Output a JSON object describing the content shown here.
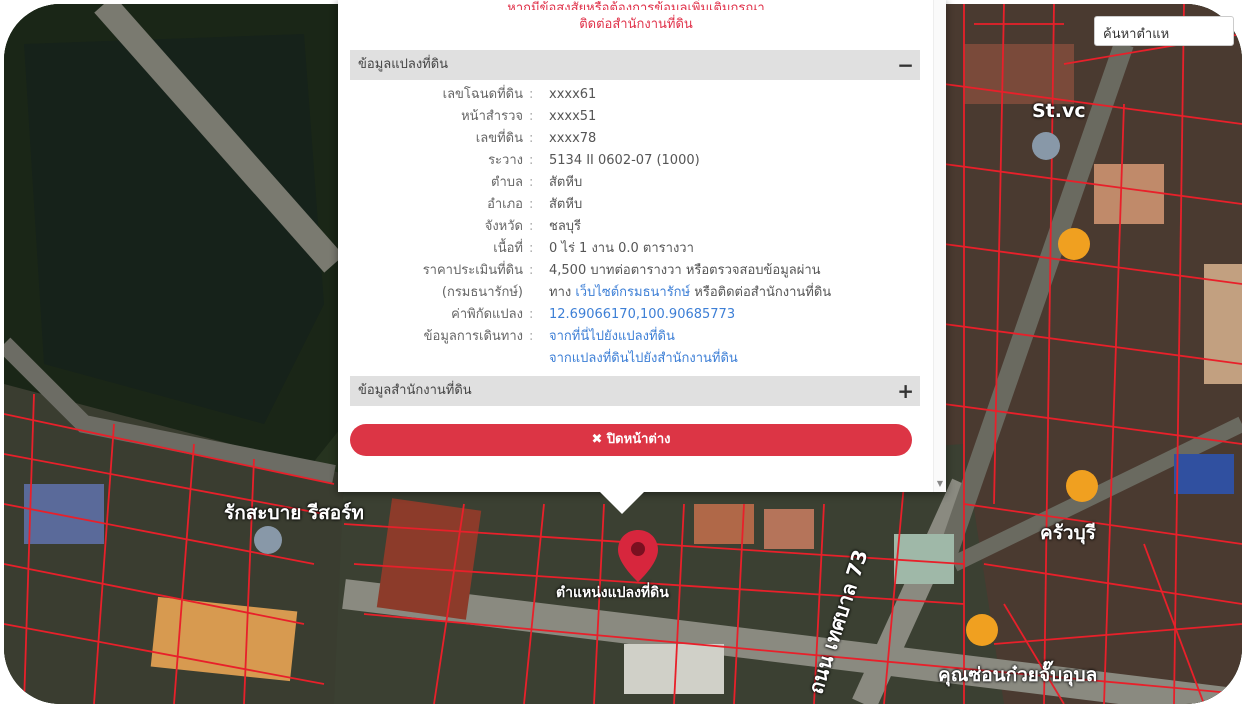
{
  "search": {
    "placeholder": "ค้นหาตำแหน่ง",
    "visible_text": "ค้นหาตำแห"
  },
  "popup": {
    "warning_cut": "หากมีข้อสงสัยหรือต้องการข้อมูลเพิ่มเติมกรุณา",
    "warning_line": "ติดต่อสำนักงานที่ดิน",
    "section1_title": "ข้อมูลแปลงที่ดิน",
    "section1_toggle": "−",
    "rows": [
      {
        "label": "เลขโฉนดที่ดิน",
        "value": "xxxx61"
      },
      {
        "label": "หน้าสำรวจ",
        "value": "xxxx51"
      },
      {
        "label": "เลขที่ดิน",
        "value": "xxxx78"
      },
      {
        "label": "ระวาง",
        "value": "5134 II 0602-07 (1000)"
      },
      {
        "label": "ตำบล",
        "value": "สัตหีบ"
      },
      {
        "label": "อำเภอ",
        "value": "สัตหีบ"
      },
      {
        "label": "จังหวัด",
        "value": "ชลบุรี"
      },
      {
        "label": "เนื้อที่",
        "value": "0 ไร่ 1 งาน 0.0 ตารางวา"
      }
    ],
    "price_label_1": "ราคาประเมินที่ดิน",
    "price_label_2": "(กรมธนารักษ์)",
    "price_value_1": "4,500 บาทต่อตารางวา หรือตรวจสอบข้อมูลผ่าน",
    "price_value_2a": "ทาง",
    "price_value_2_link": "เว็บไซต์กรมธนารักษ์",
    "price_value_2b": "หรือติดต่อสำนักงานที่ดิน",
    "coord_label": "ค่าพิกัดแปลง",
    "coord_value": "12.69066170,100.90685773",
    "travel_label": "ข้อมูลการเดินทาง",
    "travel_link_1": "จากที่นี่ไปยังแปลงที่ดิน",
    "travel_link_2": "จากแปลงที่ดินไปยังสำนักงานที่ดิน",
    "section2_title": "ข้อมูลสำนักงานที่ดิน",
    "section2_toggle": "+",
    "close_label": "✖ ปิดหน้าต่าง"
  },
  "map": {
    "labels": {
      "stvc": "St.vc",
      "resort": "รักสะบาย รีสอร์ท",
      "parcel_pos": "ตำแหน่งแปลงที่ดิน",
      "road": "ถนน เทศบาล 73",
      "krua": "ครัวบุรี",
      "shop": "คุณซ่อนก๋วยจั๊บอุบล"
    },
    "colors": {
      "parcel_line": "#e8202a",
      "popup_pin": "#d7263d",
      "poi_orange": "#f0a020"
    }
  }
}
